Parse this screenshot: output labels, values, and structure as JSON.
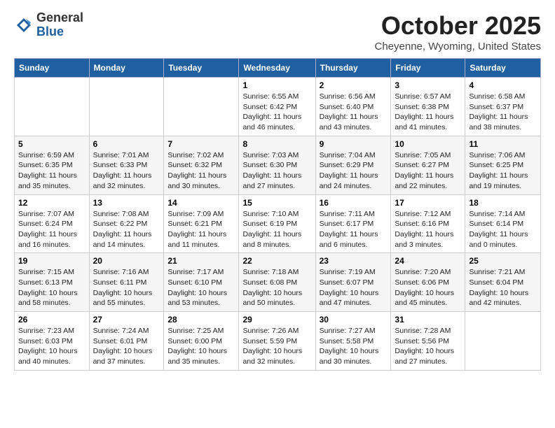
{
  "header": {
    "logo_line1": "General",
    "logo_line2": "Blue",
    "month": "October 2025",
    "location": "Cheyenne, Wyoming, United States"
  },
  "weekdays": [
    "Sunday",
    "Monday",
    "Tuesday",
    "Wednesday",
    "Thursday",
    "Friday",
    "Saturday"
  ],
  "weeks": [
    [
      {
        "day": "",
        "info": ""
      },
      {
        "day": "",
        "info": ""
      },
      {
        "day": "",
        "info": ""
      },
      {
        "day": "1",
        "info": "Sunrise: 6:55 AM\nSunset: 6:42 PM\nDaylight: 11 hours\nand 46 minutes."
      },
      {
        "day": "2",
        "info": "Sunrise: 6:56 AM\nSunset: 6:40 PM\nDaylight: 11 hours\nand 43 minutes."
      },
      {
        "day": "3",
        "info": "Sunrise: 6:57 AM\nSunset: 6:38 PM\nDaylight: 11 hours\nand 41 minutes."
      },
      {
        "day": "4",
        "info": "Sunrise: 6:58 AM\nSunset: 6:37 PM\nDaylight: 11 hours\nand 38 minutes."
      }
    ],
    [
      {
        "day": "5",
        "info": "Sunrise: 6:59 AM\nSunset: 6:35 PM\nDaylight: 11 hours\nand 35 minutes."
      },
      {
        "day": "6",
        "info": "Sunrise: 7:01 AM\nSunset: 6:33 PM\nDaylight: 11 hours\nand 32 minutes."
      },
      {
        "day": "7",
        "info": "Sunrise: 7:02 AM\nSunset: 6:32 PM\nDaylight: 11 hours\nand 30 minutes."
      },
      {
        "day": "8",
        "info": "Sunrise: 7:03 AM\nSunset: 6:30 PM\nDaylight: 11 hours\nand 27 minutes."
      },
      {
        "day": "9",
        "info": "Sunrise: 7:04 AM\nSunset: 6:29 PM\nDaylight: 11 hours\nand 24 minutes."
      },
      {
        "day": "10",
        "info": "Sunrise: 7:05 AM\nSunset: 6:27 PM\nDaylight: 11 hours\nand 22 minutes."
      },
      {
        "day": "11",
        "info": "Sunrise: 7:06 AM\nSunset: 6:25 PM\nDaylight: 11 hours\nand 19 minutes."
      }
    ],
    [
      {
        "day": "12",
        "info": "Sunrise: 7:07 AM\nSunset: 6:24 PM\nDaylight: 11 hours\nand 16 minutes."
      },
      {
        "day": "13",
        "info": "Sunrise: 7:08 AM\nSunset: 6:22 PM\nDaylight: 11 hours\nand 14 minutes."
      },
      {
        "day": "14",
        "info": "Sunrise: 7:09 AM\nSunset: 6:21 PM\nDaylight: 11 hours\nand 11 minutes."
      },
      {
        "day": "15",
        "info": "Sunrise: 7:10 AM\nSunset: 6:19 PM\nDaylight: 11 hours\nand 8 minutes."
      },
      {
        "day": "16",
        "info": "Sunrise: 7:11 AM\nSunset: 6:17 PM\nDaylight: 11 hours\nand 6 minutes."
      },
      {
        "day": "17",
        "info": "Sunrise: 7:12 AM\nSunset: 6:16 PM\nDaylight: 11 hours\nand 3 minutes."
      },
      {
        "day": "18",
        "info": "Sunrise: 7:14 AM\nSunset: 6:14 PM\nDaylight: 11 hours\nand 0 minutes."
      }
    ],
    [
      {
        "day": "19",
        "info": "Sunrise: 7:15 AM\nSunset: 6:13 PM\nDaylight: 10 hours\nand 58 minutes."
      },
      {
        "day": "20",
        "info": "Sunrise: 7:16 AM\nSunset: 6:11 PM\nDaylight: 10 hours\nand 55 minutes."
      },
      {
        "day": "21",
        "info": "Sunrise: 7:17 AM\nSunset: 6:10 PM\nDaylight: 10 hours\nand 53 minutes."
      },
      {
        "day": "22",
        "info": "Sunrise: 7:18 AM\nSunset: 6:08 PM\nDaylight: 10 hours\nand 50 minutes."
      },
      {
        "day": "23",
        "info": "Sunrise: 7:19 AM\nSunset: 6:07 PM\nDaylight: 10 hours\nand 47 minutes."
      },
      {
        "day": "24",
        "info": "Sunrise: 7:20 AM\nSunset: 6:06 PM\nDaylight: 10 hours\nand 45 minutes."
      },
      {
        "day": "25",
        "info": "Sunrise: 7:21 AM\nSunset: 6:04 PM\nDaylight: 10 hours\nand 42 minutes."
      }
    ],
    [
      {
        "day": "26",
        "info": "Sunrise: 7:23 AM\nSunset: 6:03 PM\nDaylight: 10 hours\nand 40 minutes."
      },
      {
        "day": "27",
        "info": "Sunrise: 7:24 AM\nSunset: 6:01 PM\nDaylight: 10 hours\nand 37 minutes."
      },
      {
        "day": "28",
        "info": "Sunrise: 7:25 AM\nSunset: 6:00 PM\nDaylight: 10 hours\nand 35 minutes."
      },
      {
        "day": "29",
        "info": "Sunrise: 7:26 AM\nSunset: 5:59 PM\nDaylight: 10 hours\nand 32 minutes."
      },
      {
        "day": "30",
        "info": "Sunrise: 7:27 AM\nSunset: 5:58 PM\nDaylight: 10 hours\nand 30 minutes."
      },
      {
        "day": "31",
        "info": "Sunrise: 7:28 AM\nSunset: 5:56 PM\nDaylight: 10 hours\nand 27 minutes."
      },
      {
        "day": "",
        "info": ""
      }
    ]
  ]
}
